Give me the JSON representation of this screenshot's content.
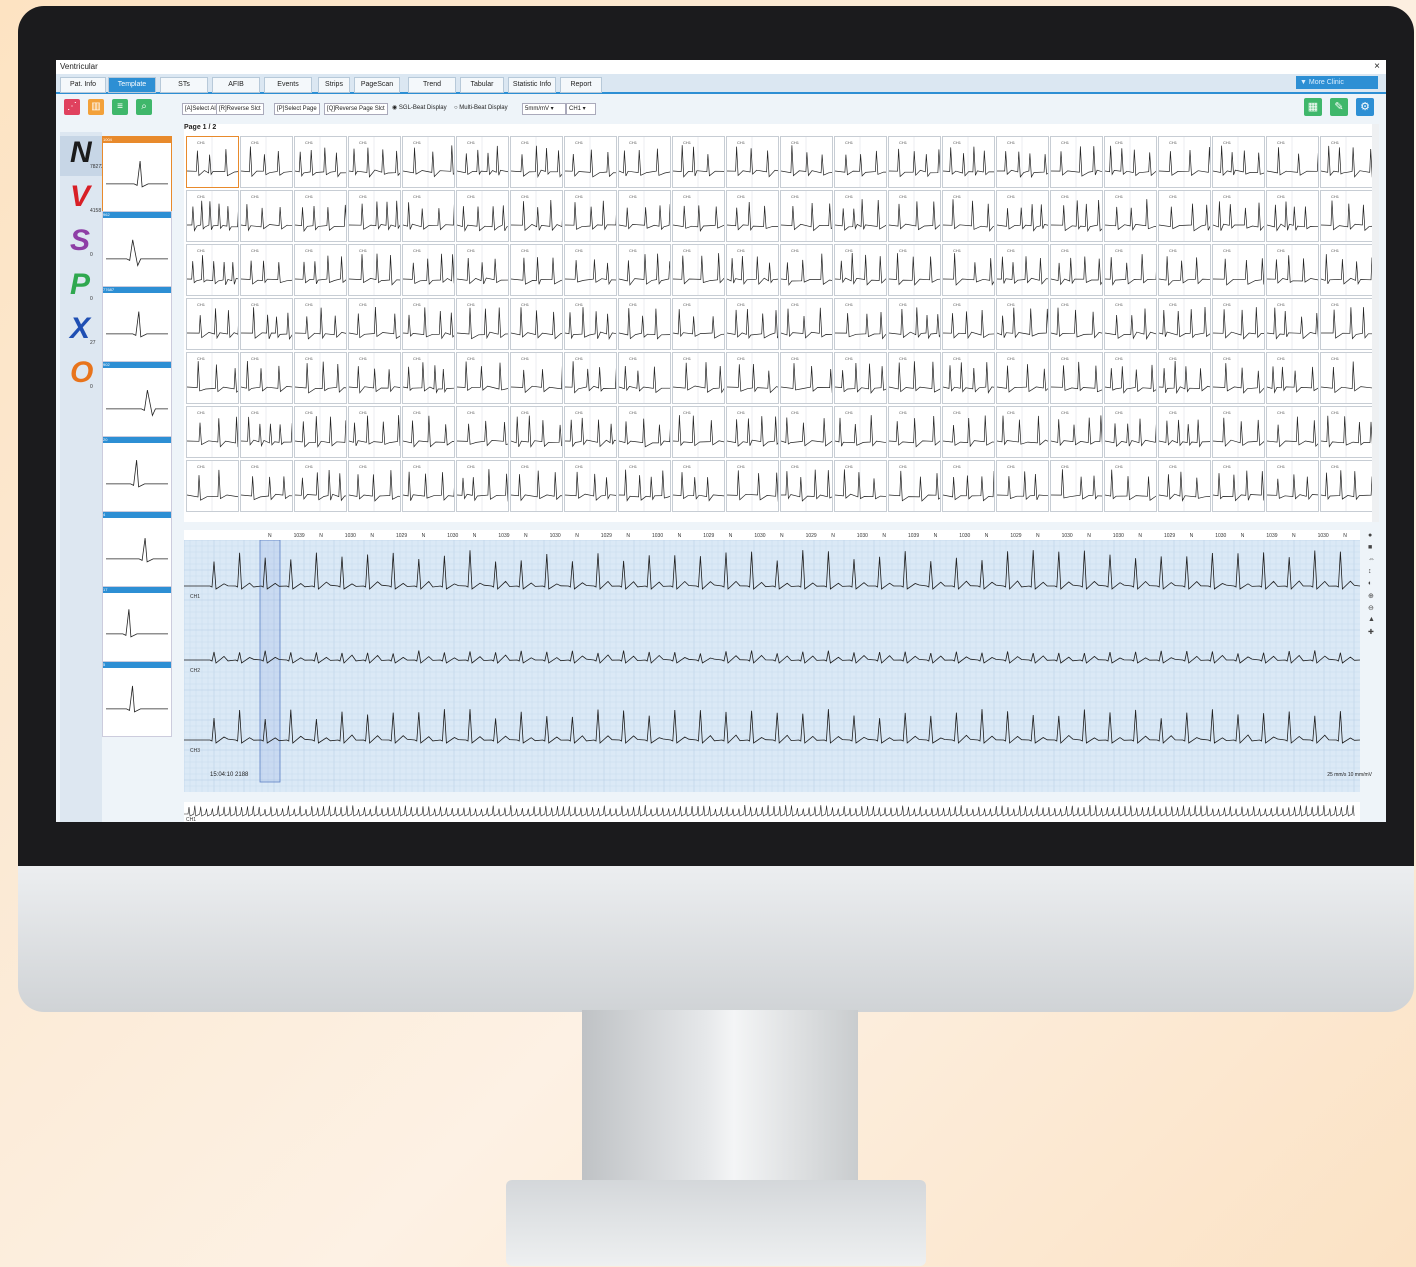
{
  "window": {
    "title": "Ventricular",
    "close_glyph": "×"
  },
  "tabs": [
    {
      "label": "Pat. Info",
      "active": false
    },
    {
      "label": "Template",
      "active": true
    },
    {
      "label": "STs",
      "active": false
    },
    {
      "label": "AFIB",
      "active": false
    },
    {
      "label": "Events",
      "active": false
    },
    {
      "label": "Strips",
      "active": false
    },
    {
      "label": "PageScan",
      "active": false
    },
    {
      "label": "Trend",
      "active": false
    },
    {
      "label": "Tabular",
      "active": false
    },
    {
      "label": "Statistic Info",
      "active": false
    },
    {
      "label": "Report",
      "active": false
    }
  ],
  "more_button": "▼ More Clinic",
  "toolbar": {
    "left_icons": [
      {
        "name": "scatter-chart-icon",
        "color": "#e0415e"
      },
      {
        "name": "bar-chart-icon",
        "color": "#f3a13a"
      },
      {
        "name": "list-icon",
        "color": "#3fb76b"
      },
      {
        "name": "search-document-icon",
        "color": "#3fb76b"
      }
    ],
    "buttons": [
      "[A]Select All",
      "[R]Reverse Slct",
      "[P]Select Page",
      "[Q]Reverse Page Slct"
    ],
    "radio_single": "SGL-Beat Display",
    "radio_multi": "Multi-Beat Display",
    "scale_select": "5mm/mV",
    "channel_select": "CH1",
    "right_icons": [
      {
        "name": "layout-icon",
        "color": "#3fb76b"
      },
      {
        "name": "edit-icon",
        "color": "#3fb76b"
      },
      {
        "name": "settings-icon",
        "color": "#2d8fd4"
      }
    ]
  },
  "categories": [
    {
      "letter": "N",
      "count": "78272",
      "color": "#1b1b1b"
    },
    {
      "letter": "V",
      "count": "4158",
      "color": "#d81f26"
    },
    {
      "letter": "S",
      "count": "0",
      "color": "#8e3ea6"
    },
    {
      "letter": "P",
      "count": "0",
      "color": "#2fa84f"
    },
    {
      "letter": "X",
      "count": "27",
      "color": "#1f4fb3"
    },
    {
      "letter": "O",
      "count": "0",
      "color": "#e8741c"
    }
  ],
  "templates": [
    {
      "id": "1004"
    },
    {
      "id": "962"
    },
    {
      "id": "77687"
    },
    {
      "id": "902"
    },
    {
      "id": "20"
    },
    {
      "id": "4"
    },
    {
      "id": "17"
    },
    {
      "id": "5"
    }
  ],
  "grid": {
    "page_label": "Page 1 / 2",
    "cell_label": "CH1",
    "rows": 7,
    "cols": 22
  },
  "strip": {
    "beat_labels": [
      "N",
      "1039",
      "N",
      "1030",
      "N",
      "1029",
      "N",
      "1030",
      "N",
      "1039",
      "N",
      "1030",
      "N",
      "1029",
      "N",
      "1030",
      "N",
      "1029",
      "N",
      "1030",
      "N",
      "1029",
      "N",
      "1030",
      "N",
      "1039",
      "N",
      "1030",
      "N",
      "1029",
      "N",
      "1030",
      "N",
      "1030",
      "N",
      "1029",
      "N",
      "1030",
      "N",
      "1039",
      "N",
      "1030",
      "N",
      "1030",
      "N",
      "1029",
      "N"
    ],
    "channels": [
      "CH1",
      "CH2",
      "CH3"
    ],
    "timestamp": "15:04:10 2188",
    "speed": "25 mm/s  10 mm/mV",
    "overview_label": "CH1"
  }
}
